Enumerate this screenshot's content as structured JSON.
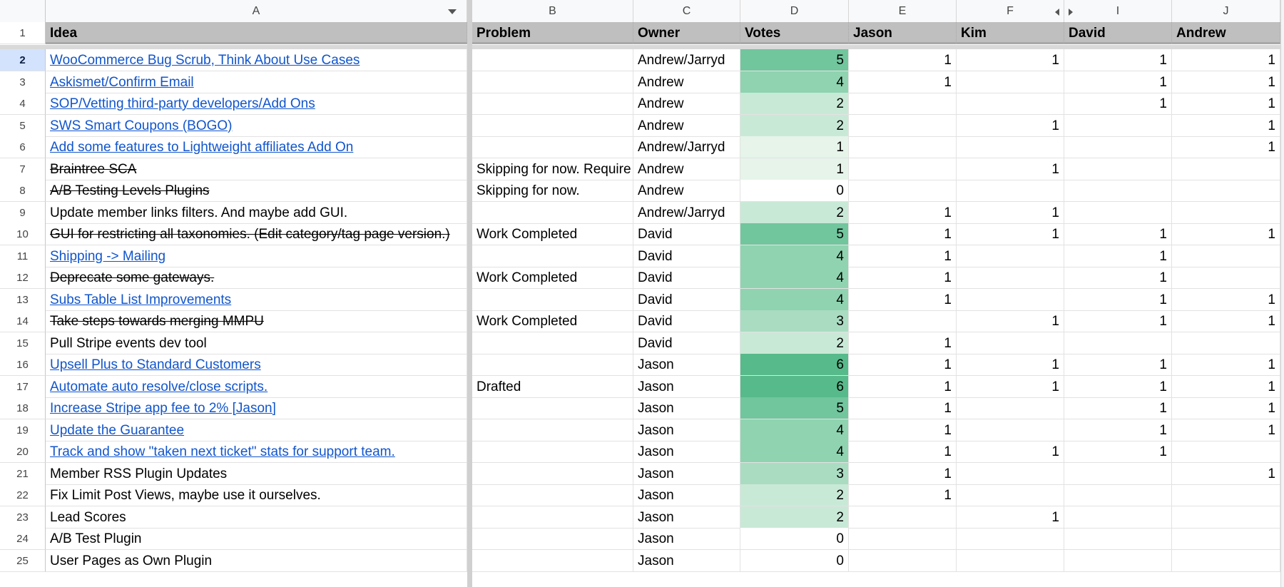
{
  "columns": {
    "letters": [
      "A",
      "B",
      "C",
      "D",
      "E",
      "F",
      "I",
      "J"
    ]
  },
  "header_row": {
    "number": "1",
    "cells": [
      "Idea",
      "Problem",
      "Owner",
      "Votes",
      "Jason",
      "Kim",
      "David",
      "Andrew"
    ]
  },
  "vote_colors": {
    "0": "#ffffff",
    "1": "#e6f4ea",
    "2": "#c9e9d7",
    "3": "#aadcc2",
    "4": "#8fd3b0",
    "5": "#71c69d",
    "6": "#57ba8a"
  },
  "colors": {
    "link": "#1155cc",
    "header_bg": "#bfbfbf",
    "selected_row_header": "#d3e3fd"
  },
  "selected_row": "2",
  "rows": [
    {
      "num": "2",
      "idea": "WooCommerce Bug Scrub, Think About Use Cases",
      "style": "link",
      "problem": "",
      "owner": "Andrew/Jarryd",
      "votes": "5",
      "jason": "1",
      "kim": "1",
      "david": "1",
      "andrew": "1"
    },
    {
      "num": "3",
      "idea": "Askismet/Confirm Email",
      "style": "link",
      "problem": "",
      "owner": "Andrew",
      "votes": "4",
      "jason": "1",
      "kim": "",
      "david": "1",
      "andrew": "1"
    },
    {
      "num": "4",
      "idea": "SOP/Vetting third-party developers/Add Ons",
      "style": "link",
      "problem": "",
      "owner": "Andrew",
      "votes": "2",
      "jason": "",
      "kim": "",
      "david": "1",
      "andrew": "1"
    },
    {
      "num": "5",
      "idea": "SWS Smart Coupons (BOGO)",
      "style": "link",
      "problem": "",
      "owner": "Andrew",
      "votes": "2",
      "jason": "",
      "kim": "1",
      "david": "",
      "andrew": "1"
    },
    {
      "num": "6",
      "idea": "Add some features to Lightweight affiliates Add On",
      "style": "link",
      "problem": "",
      "owner": "Andrew/Jarryd",
      "votes": "1",
      "jason": "",
      "kim": "",
      "david": "",
      "andrew": "1"
    },
    {
      "num": "7",
      "idea": "Braintree SCA",
      "style": "strike",
      "problem": "Skipping for now. Require",
      "owner": "Andrew",
      "votes": "1",
      "jason": "",
      "kim": "1",
      "david": "",
      "andrew": ""
    },
    {
      "num": "8",
      "idea": "A/B Testing Levels Plugins",
      "style": "strike",
      "problem": "Skipping for now.",
      "owner": "Andrew",
      "votes": "0",
      "jason": "",
      "kim": "",
      "david": "",
      "andrew": ""
    },
    {
      "num": "9",
      "idea": "Update member links filters. And maybe add GUI.",
      "style": "plain",
      "problem": "",
      "owner": "Andrew/Jarryd",
      "votes": "2",
      "jason": "1",
      "kim": "1",
      "david": "",
      "andrew": ""
    },
    {
      "num": "10",
      "idea": "GUI for restricting all taxonomies. (Edit category/tag page version.)",
      "style": "strike",
      "problem": "Work Completed",
      "owner": "David",
      "votes": "5",
      "jason": "1",
      "kim": "1",
      "david": "1",
      "andrew": "1"
    },
    {
      "num": "11",
      "idea": "Shipping -> Mailing",
      "style": "link",
      "problem": "",
      "owner": "David",
      "votes": "4",
      "jason": "1",
      "kim": "",
      "david": "1",
      "andrew": ""
    },
    {
      "num": "12",
      "idea": "Deprecate some gateways.",
      "style": "strike",
      "problem": "Work Completed",
      "owner": "David",
      "votes": "4",
      "jason": "1",
      "kim": "",
      "david": "1",
      "andrew": ""
    },
    {
      "num": "13",
      "idea": "Subs Table List Improvements",
      "style": "link",
      "problem": "",
      "owner": "David",
      "votes": "4",
      "jason": "1",
      "kim": "",
      "david": "1",
      "andrew": "1"
    },
    {
      "num": "14",
      "idea": "Take steps towards merging MMPU",
      "style": "strike",
      "problem": "Work Completed",
      "owner": "David",
      "votes": "3",
      "jason": "",
      "kim": "1",
      "david": "1",
      "andrew": "1"
    },
    {
      "num": "15",
      "idea": "Pull Stripe events dev tool",
      "style": "plain",
      "problem": "",
      "owner": "David",
      "votes": "2",
      "jason": "1",
      "kim": "",
      "david": "",
      "andrew": ""
    },
    {
      "num": "16",
      "idea": "Upsell Plus to Standard Customers",
      "style": "link",
      "problem": "",
      "owner": "Jason",
      "votes": "6",
      "jason": "1",
      "kim": "1",
      "david": "1",
      "andrew": "1"
    },
    {
      "num": "17",
      "idea": "Automate auto resolve/close scripts.",
      "style": "link",
      "problem": "Drafted",
      "owner": "Jason",
      "votes": "6",
      "jason": "1",
      "kim": "1",
      "david": "1",
      "andrew": "1"
    },
    {
      "num": "18",
      "idea": "Increase Stripe app fee to 2% [Jason]",
      "style": "link",
      "problem": "",
      "owner": "Jason",
      "votes": "5",
      "jason": "1",
      "kim": "",
      "david": "1",
      "andrew": "1"
    },
    {
      "num": "19",
      "idea": "Update the Guarantee",
      "style": "link",
      "problem": "",
      "owner": "Jason",
      "votes": "4",
      "jason": "1",
      "kim": "",
      "david": "1",
      "andrew": "1"
    },
    {
      "num": "20",
      "idea": "Track and show \"taken next ticket\" stats for support team.",
      "style": "link",
      "problem": "",
      "owner": "Jason",
      "votes": "4",
      "jason": "1",
      "kim": "1",
      "david": "1",
      "andrew": ""
    },
    {
      "num": "21",
      "idea": "Member RSS Plugin Updates",
      "style": "plain",
      "problem": "",
      "owner": "Jason",
      "votes": "3",
      "jason": "1",
      "kim": "",
      "david": "",
      "andrew": "1"
    },
    {
      "num": "22",
      "idea": "Fix Limit Post Views, maybe use it ourselves.",
      "style": "plain",
      "problem": "",
      "owner": "Jason",
      "votes": "2",
      "jason": "1",
      "kim": "",
      "david": "",
      "andrew": ""
    },
    {
      "num": "23",
      "idea": "Lead Scores",
      "style": "plain",
      "problem": "",
      "owner": "Jason",
      "votes": "2",
      "jason": "",
      "kim": "1",
      "david": "",
      "andrew": ""
    },
    {
      "num": "24",
      "idea": "A/B Test Plugin",
      "style": "plain",
      "problem": "",
      "owner": "Jason",
      "votes": "0",
      "jason": "",
      "kim": "",
      "david": "",
      "andrew": ""
    },
    {
      "num": "25",
      "idea": "User Pages as Own Plugin",
      "style": "plain",
      "problem": "",
      "owner": "Jason",
      "votes": "0",
      "jason": "",
      "kim": "",
      "david": "",
      "andrew": ""
    }
  ]
}
